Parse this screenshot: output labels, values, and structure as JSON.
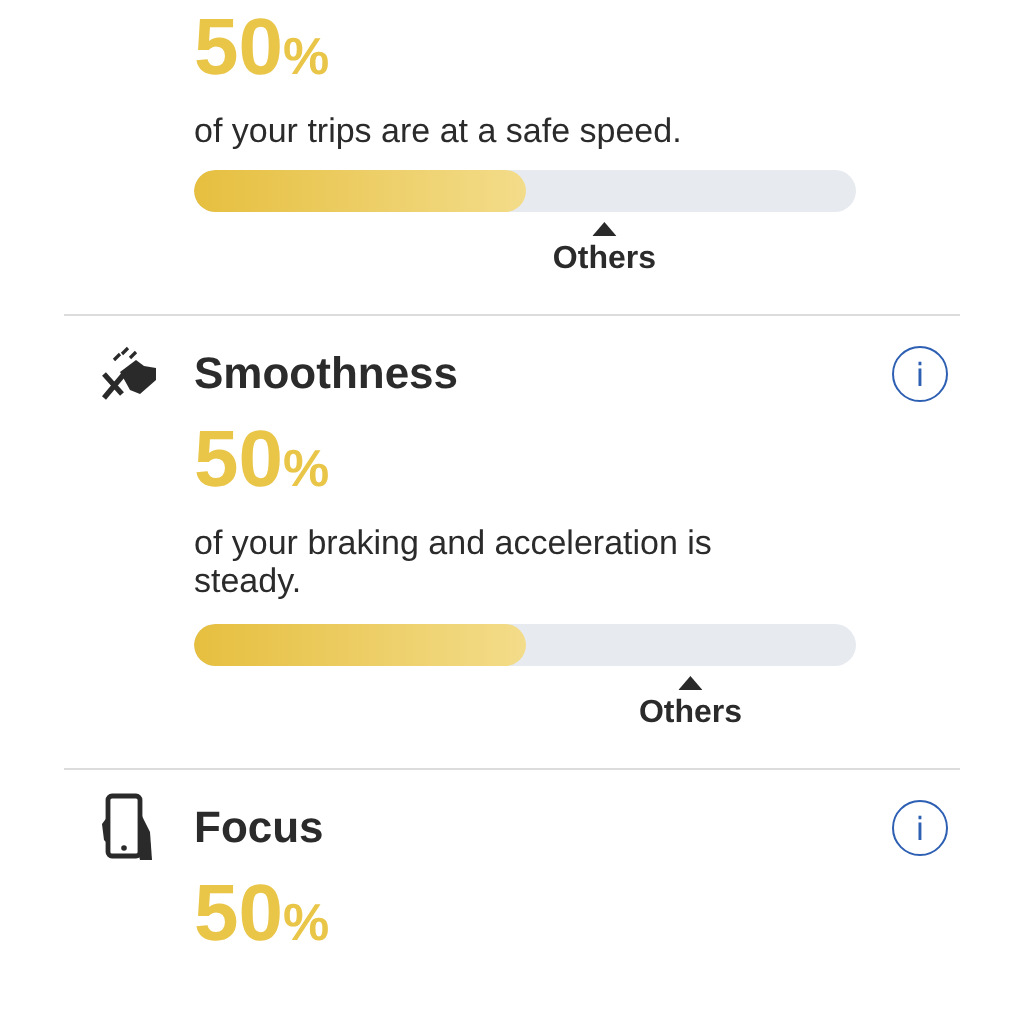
{
  "sections": [
    {
      "value": "50",
      "unit": "%",
      "description": "of your trips are at a safe speed.",
      "level": 0.5,
      "marker": {
        "label": "Others"
      }
    },
    {
      "title": "Smoothness",
      "info": "i",
      "value": "50",
      "unit": "%",
      "description": "of your braking and acceleration is steady.",
      "level": 0.5,
      "marker": {
        "label": "Others"
      }
    },
    {
      "title": "Focus",
      "info": "i",
      "value": "50",
      "unit": "%"
    }
  ]
}
